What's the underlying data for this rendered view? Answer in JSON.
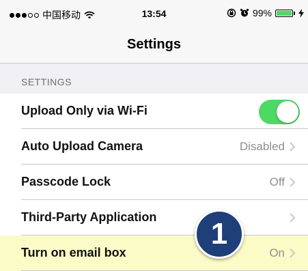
{
  "status_bar": {
    "carrier": "中国移动",
    "time": "13:54",
    "battery_percent": "99%",
    "battery_level": 0.99,
    "icons": [
      "signal-dots-icon",
      "wifi-icon",
      "lock-rotation-icon",
      "alarm-icon",
      "battery-icon",
      "charging-icon"
    ]
  },
  "nav": {
    "title": "Settings"
  },
  "section": {
    "header": "SETTINGS"
  },
  "rows": [
    {
      "label": "Upload Only via Wi-Fi",
      "toggle_on": true
    },
    {
      "label": "Auto Upload Camera",
      "value": "Disabled"
    },
    {
      "label": "Passcode Lock",
      "value": "Off"
    },
    {
      "label": "Third-Party Application",
      "value": ""
    },
    {
      "label": "Turn on email box",
      "value": "On"
    }
  ],
  "annotation": {
    "step": "1"
  },
  "colors": {
    "toggle_on": "#4cd964",
    "highlight": "#fbfbc8",
    "badge": "#1f3f78",
    "secondary_text": "#8e8e93"
  }
}
